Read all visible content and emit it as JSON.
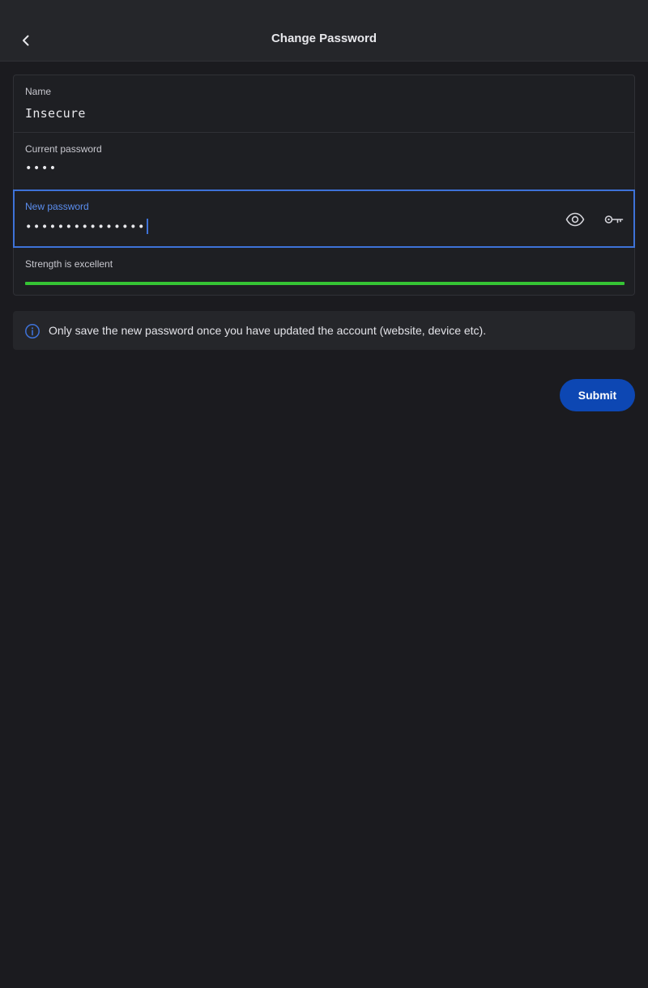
{
  "header": {
    "title": "Change Password",
    "back_icon": "chevron-left-icon"
  },
  "form": {
    "name": {
      "label": "Name",
      "value": "Insecure"
    },
    "current_password": {
      "label": "Current password",
      "value": "••••"
    },
    "new_password": {
      "label": "New password",
      "value": "•••••••••••••••",
      "show_icon": "eye-icon",
      "generate_icon": "key-icon"
    },
    "strength": {
      "label": "Strength is excellent",
      "level": 1.0,
      "color": "#35c434"
    }
  },
  "info": {
    "icon": "info-icon",
    "text": "Only save the new password once you have updated the account (website, device etc)."
  },
  "actions": {
    "submit_label": "Submit"
  },
  "colors": {
    "accent": "#3e72d8",
    "button": "#0d47b3",
    "background": "#1b1b1f"
  }
}
